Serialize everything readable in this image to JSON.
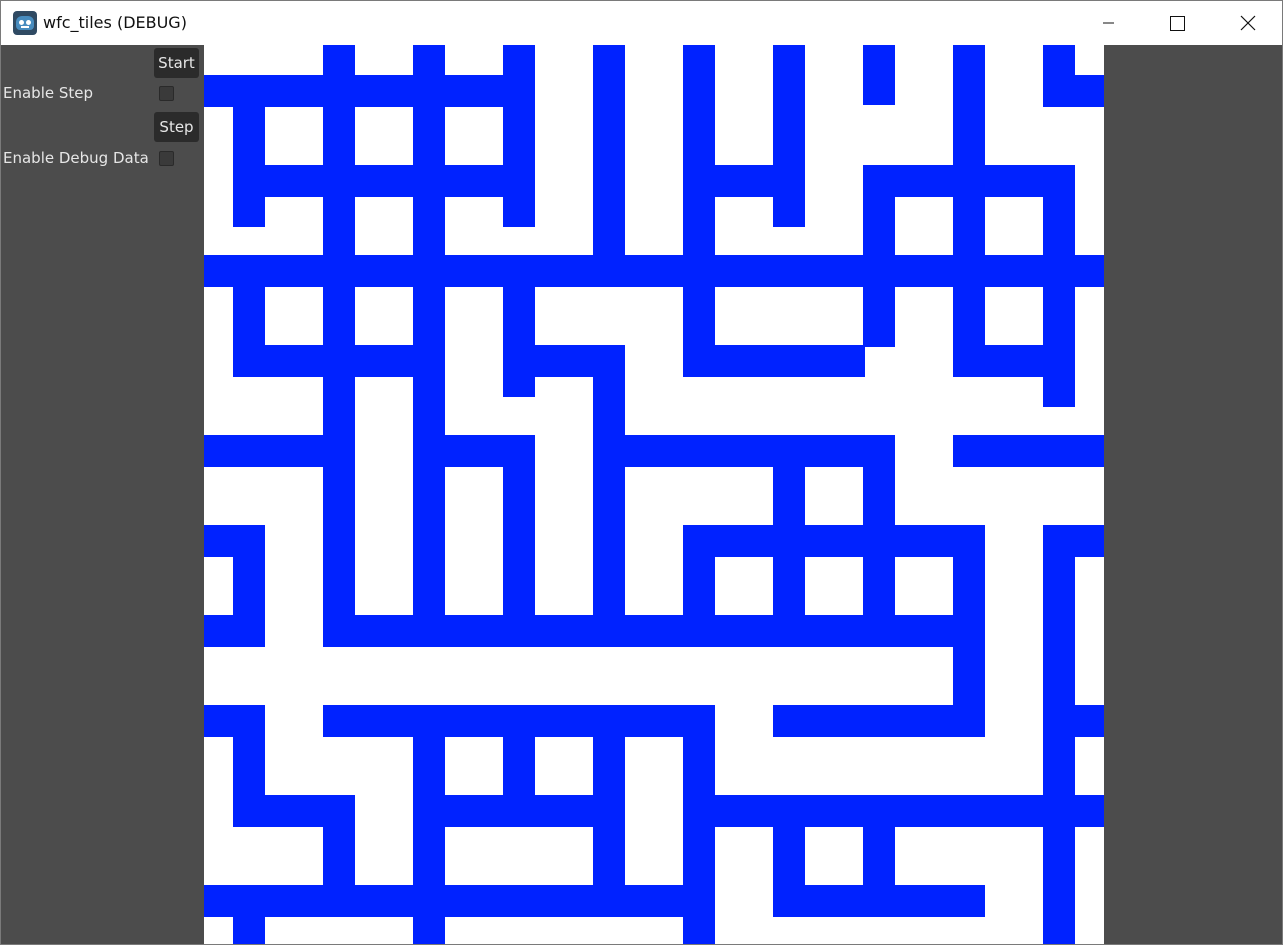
{
  "window": {
    "title": "wfc_tiles (DEBUG)",
    "icon": "godot-engine-icon"
  },
  "controls": {
    "start_label": "Start",
    "enable_step_label": "Enable Step",
    "enable_step_checked": false,
    "step_label": "Step",
    "enable_debug_label": "Enable Debug Data",
    "enable_debug_checked": false
  },
  "colors": {
    "wall": "#0022ff",
    "floor": "#ffffff",
    "panel": "#4c4c4c",
    "button": "#2b2b2b"
  }
}
